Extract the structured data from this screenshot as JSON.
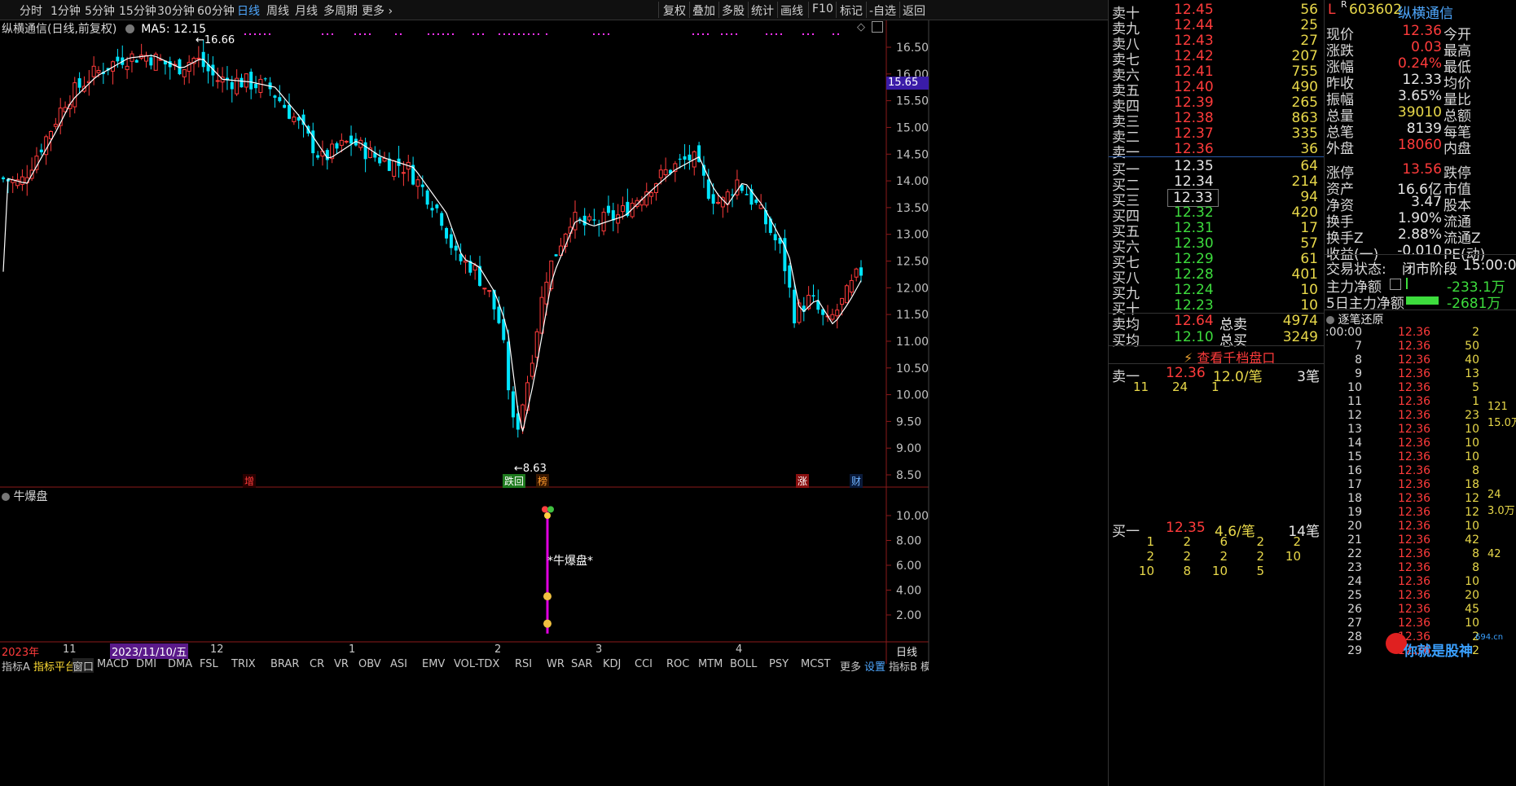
{
  "toolbar": {
    "left_items": [
      "分时",
      "1分钟",
      "5分钟",
      "15分钟",
      "30分钟",
      "60分钟",
      "日线",
      "周线",
      "月线",
      "多周期",
      "更多"
    ],
    "active": "日线",
    "right_items": [
      "复权",
      "叠加",
      "多股",
      "统计",
      "画线",
      "F10",
      "标记",
      "-自选",
      "返回"
    ]
  },
  "chart": {
    "stock_title": "纵横通信(日线,前复权)",
    "ma_label": "MA5: 12.15",
    "high_label": "16.66",
    "low_label": "8.63",
    "current_price_tag": "15.65",
    "price_ticks": [
      "16.50",
      "16.00",
      "15.50",
      "15.00",
      "14.50",
      "14.00",
      "13.50",
      "13.00",
      "12.50",
      "12.00",
      "11.50",
      "11.00",
      "10.50",
      "10.00",
      "9.50",
      "9.00",
      "8.50"
    ],
    "markers": [
      {
        "text": "增",
        "color": "#ff3b3b",
        "bg": "#2a0000"
      },
      {
        "text": "跌回",
        "color": "#ffffff",
        "bg": "#1e7a1e"
      },
      {
        "text": "榜",
        "color": "#ff9b2b",
        "bg": "#3a1800"
      },
      {
        "text": "涨",
        "color": "#ffffff",
        "bg": "#8a1010"
      },
      {
        "text": "财",
        "color": "#6fb3ff",
        "bg": "#0a1a3a"
      }
    ],
    "indicator_title": "牛爆盘",
    "indicator_label": "*牛爆盘*",
    "indicator_ticks": [
      "10.00",
      "8.00",
      "6.00",
      "4.00",
      "2.00"
    ],
    "date_axis": {
      "year": "2023年",
      "m11": "11",
      "cursor_date": "2023/11/10/五",
      "m12": "12",
      "m1": "1",
      "m2": "2",
      "m3": "3",
      "m4": "4",
      "period": "日线"
    },
    "bottom_tabs": [
      "指标A",
      "指标平台",
      "窗口",
      "MACD",
      "DMI",
      "DMA",
      "FSL",
      "TRIX",
      "BRAR",
      "CR",
      "VR",
      "OBV",
      "ASI",
      "EMV",
      "VOL-TDX",
      "RSI",
      "WR",
      "SAR",
      "KDJ",
      "CCI",
      "ROC",
      "MTM",
      "BOLL",
      "PSY",
      "MCST",
      "更多",
      "设置",
      "指标B",
      "模板"
    ],
    "up_color": "#ff3b3b",
    "down_color": "#00e5ff"
  },
  "book": {
    "asks": [
      {
        "label": "卖十",
        "price": "12.45",
        "vol": "56"
      },
      {
        "label": "卖九",
        "price": "12.44",
        "vol": "25"
      },
      {
        "label": "卖八",
        "price": "12.43",
        "vol": "27"
      },
      {
        "label": "卖七",
        "price": "12.42",
        "vol": "207"
      },
      {
        "label": "卖六",
        "price": "12.41",
        "vol": "755"
      },
      {
        "label": "卖五",
        "price": "12.40",
        "vol": "490"
      },
      {
        "label": "卖四",
        "price": "12.39",
        "vol": "265"
      },
      {
        "label": "卖三",
        "price": "12.38",
        "vol": "863"
      },
      {
        "label": "卖二",
        "price": "12.37",
        "vol": "335"
      },
      {
        "label": "卖一",
        "price": "12.36",
        "vol": "36"
      }
    ],
    "bids": [
      {
        "label": "买一",
        "price": "12.35",
        "vol": "64"
      },
      {
        "label": "买二",
        "price": "12.34",
        "vol": "214"
      },
      {
        "label": "买三",
        "price": "12.33",
        "vol": "94"
      },
      {
        "label": "买四",
        "price": "12.32",
        "vol": "420"
      },
      {
        "label": "买五",
        "price": "12.31",
        "vol": "17"
      },
      {
        "label": "买六",
        "price": "12.30",
        "vol": "57"
      },
      {
        "label": "买七",
        "price": "12.29",
        "vol": "61"
      },
      {
        "label": "买八",
        "price": "12.28",
        "vol": "401"
      },
      {
        "label": "买九",
        "price": "12.24",
        "vol": "10"
      },
      {
        "label": "买十",
        "price": "12.23",
        "vol": "10"
      }
    ],
    "avg_sell_label": "卖均",
    "avg_sell": "12.64",
    "total_sell_label": "总卖",
    "total_sell": "4974",
    "avg_buy_label": "买均",
    "avg_buy": "12.10",
    "total_buy_label": "总买",
    "total_buy": "3249",
    "qianDang": "查看千档盘口",
    "sell1_label": "卖一",
    "sell1_price": "12.36",
    "sell1_avg": "12.0/笔",
    "sell1_count": "3笔",
    "sell1_queue": [
      "11",
      "24",
      "1"
    ],
    "buy1_label": "买一",
    "buy1_price": "12.35",
    "buy1_avg": "4.6/笔",
    "buy1_count": "14笔",
    "buy1_queue": [
      "1",
      "2",
      "6",
      "2",
      "2",
      "2",
      "2",
      "2",
      "2",
      "10",
      "10",
      "8",
      "10",
      "5"
    ]
  },
  "quote": {
    "flag_l": "L",
    "flag_r": "R",
    "code": "603602",
    "name": "纵横通信",
    "rows": [
      {
        "l1": "现价",
        "v1": "12.36",
        "c1": "red",
        "l2": "今开"
      },
      {
        "l1": "涨跌",
        "v1": "0.03",
        "c1": "red",
        "l2": "最高"
      },
      {
        "l1": "涨幅",
        "v1": "0.24%",
        "c1": "red",
        "l2": "最低"
      },
      {
        "l1": "昨收",
        "v1": "12.33",
        "c1": "white",
        "l2": "均价"
      },
      {
        "l1": "振幅",
        "v1": "3.65%",
        "c1": "white",
        "l2": "量比"
      },
      {
        "l1": "总量",
        "v1": "39010",
        "c1": "yellow",
        "l2": "总额"
      },
      {
        "l1": "总笔",
        "v1": "8139",
        "c1": "white",
        "l2": "每笔"
      },
      {
        "l1": "外盘",
        "v1": "18060",
        "c1": "red",
        "l2": "内盘"
      },
      {
        "l1": "涨停",
        "v1": "13.56",
        "c1": "red",
        "l2": "跌停"
      },
      {
        "l1": "资产",
        "v1": "16.6亿",
        "c1": "white",
        "l2": "市值"
      },
      {
        "l1": "净资",
        "v1": "3.47",
        "c1": "white",
        "l2": "股本"
      },
      {
        "l1": "换手",
        "v1": "1.90%",
        "c1": "white",
        "l2": "流通"
      },
      {
        "l1": "换手Z",
        "v1": "2.88%",
        "c1": "white",
        "l2": "流通Z"
      },
      {
        "l1": "收益(一)",
        "v1": "-0.010",
        "c1": "white",
        "l2": "PE(动)"
      }
    ],
    "state_label": "交易状态:",
    "state_value": "闭市阶段",
    "state_time": "15:00:0",
    "main_net_label": "主力净额",
    "main_net_value": "-233.1万",
    "main5_label": "5日主力净额",
    "main5_value": "-2681万",
    "ticks_title": "逐笔还原",
    "ticks": [
      {
        "t": "15:00:00",
        "p": "12.36",
        "v": "2"
      },
      {
        "t": "7",
        "p": "12.36",
        "v": "50"
      },
      {
        "t": "8",
        "p": "12.36",
        "v": "40"
      },
      {
        "t": "9",
        "p": "12.36",
        "v": "13"
      },
      {
        "t": "10",
        "p": "12.36",
        "v": "5"
      },
      {
        "t": "11",
        "p": "12.36",
        "v": "1"
      },
      {
        "t": "12",
        "p": "12.36",
        "v": "23"
      },
      {
        "t": "13",
        "p": "12.36",
        "v": "10"
      },
      {
        "t": "14",
        "p": "12.36",
        "v": "10"
      },
      {
        "t": "15",
        "p": "12.36",
        "v": "10"
      },
      {
        "t": "16",
        "p": "12.36",
        "v": "8"
      },
      {
        "t": "17",
        "p": "12.36",
        "v": "18"
      },
      {
        "t": "18",
        "p": "12.36",
        "v": "12"
      },
      {
        "t": "19",
        "p": "12.36",
        "v": "12"
      },
      {
        "t": "20",
        "p": "12.36",
        "v": "10"
      },
      {
        "t": "21",
        "p": "12.36",
        "v": "42"
      },
      {
        "t": "22",
        "p": "12.36",
        "v": "8"
      },
      {
        "t": "23",
        "p": "12.36",
        "v": "8"
      },
      {
        "t": "24",
        "p": "12.36",
        "v": "10"
      },
      {
        "t": "25",
        "p": "12.36",
        "v": "20"
      },
      {
        "t": "26",
        "p": "12.36",
        "v": "45"
      },
      {
        "t": "27",
        "p": "12.36",
        "v": "10"
      },
      {
        "t": "28",
        "p": "12.36",
        "v": "2"
      },
      {
        "t": "29",
        "p": "12.36",
        "v": "2"
      }
    ],
    "side_nums": [
      "121",
      "15.0万",
      "24",
      "3.0万",
      "42"
    ],
    "watermark": "你就是股神",
    "watermark_sub": "694.cn"
  }
}
